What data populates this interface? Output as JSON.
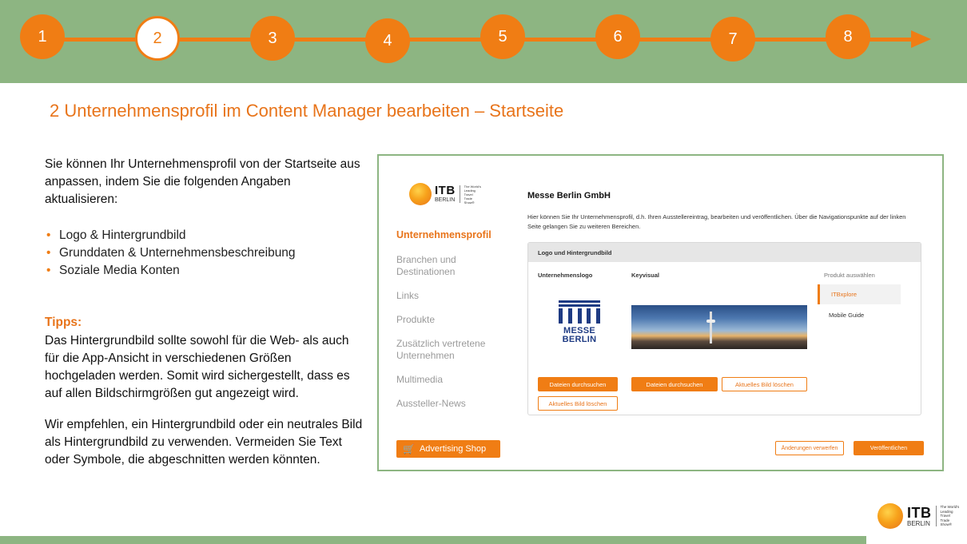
{
  "steps": [
    "1",
    "2",
    "3",
    "4",
    "5",
    "6",
    "7",
    "8"
  ],
  "active_step": "2",
  "title": "2 Unternehmensprofil im Content Manager bearbeiten – Startseite",
  "intro": "Sie können Ihr Unternehmensprofil von der Startseite aus anpassen, indem Sie die folgenden Angaben aktualisieren:",
  "bullets": [
    "Logo & Hintergrundbild",
    "Grunddaten & Unternehmensbeschreibung",
    "Soziale Media Konten"
  ],
  "tips_label": "Tipps:",
  "tips_text": "Das Hintergrundbild sollte sowohl für die Web- als auch für die App-Ansicht in verschiedenen Größen hochgeladen werden. Somit wird sichergestellt, dass es auf allen Bildschirmgrößen gut angezeigt wird.",
  "tips_text2": "Wir empfehlen, ein Hintergrundbild oder ein neutrales Bild als Hintergrundbild zu verwenden. Vermeiden Sie Text oder Symbole, die abgeschnitten werden könnten.",
  "logo": {
    "wordmark": "ITB",
    "city": "BERLIN",
    "tagline": "The World's Leading Travel Trade Show®"
  },
  "cm": {
    "nav": [
      "Unternehmensprofil",
      "Branchen und Destinationen",
      "Links",
      "Produkte",
      "Zusätzlich vertretene Unternehmen",
      "Multimedia",
      "Aussteller-News"
    ],
    "advertising_shop": "Advertising Shop",
    "company_name": "Messe Berlin GmbH",
    "description": "Hier können Sie Ihr Unternehmensprofil, d.h. Ihren Ausstellereintrag, bearbeiten und veröffentlichen. Über die Navigationspunkte auf der linken Seite gelangen Sie zu weiteren Bereichen.",
    "card_title": "Logo und Hintergrundbild",
    "logo_label": "Unternehmenslogo",
    "keyvisual_label": "Keyvisual",
    "product_label": "Produkt auswählen",
    "products": [
      "ITBxplore",
      "Mobile Guide"
    ],
    "messe_logo": "MESSE BERLIN",
    "browse": "Dateien durchsuchen",
    "delete": "Aktuelles Bild löschen",
    "discard": "Änderungen verwerfen",
    "publish": "Veröffentlichen"
  },
  "colors": {
    "accent": "#f07d14",
    "green": "#8db582",
    "messe_blue": "#1e3b83"
  }
}
